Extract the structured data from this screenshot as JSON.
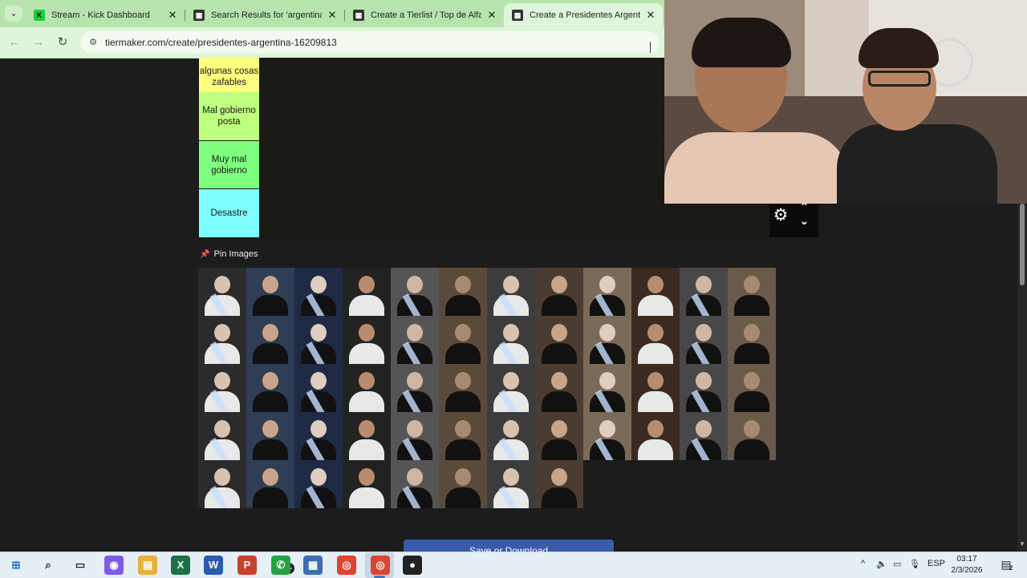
{
  "browser": {
    "tabs": [
      {
        "title": "Stream - Kick Dashboard",
        "favicon": "kick-icon",
        "active": false
      },
      {
        "title": "Search Results for 'argentina' -",
        "favicon": "tiermaker-icon",
        "active": false
      },
      {
        "title": "Create a Tierlist / Top de Alfajor",
        "favicon": "tiermaker-icon",
        "active": false
      },
      {
        "title": "Create a Presidentes Argentina",
        "favicon": "tiermaker-icon",
        "active": true
      }
    ],
    "tab_close": "✕",
    "tab_dropdown": "⌄",
    "nav": {
      "back": "←",
      "forward": "→",
      "reload": "↻",
      "site_info": "⚙"
    },
    "url": "tiermaker.com/create/presidentes-argentina-16209813"
  },
  "tierlist": {
    "tiers": [
      {
        "label": "algunas cosas zafables",
        "color": "#ffff7f"
      },
      {
        "label": "Mal gobierno posta",
        "color": "#bfff7f"
      },
      {
        "label": "Muy mal gobierno",
        "color": "#7fff7f"
      },
      {
        "label": "Desastre",
        "color": "#7fffff"
      }
    ],
    "settings": {
      "gear": "⚙",
      "up": "⌃",
      "down": "⌄"
    },
    "pin_label": "Pin Images",
    "pin_icon": "📌",
    "image_rows": [
      12,
      12,
      12,
      12,
      8
    ],
    "save_button": "Save or Download"
  },
  "taskbar": {
    "icons": [
      {
        "name": "windows-start-icon",
        "glyph": "⊞",
        "color": "#1a6fd1"
      },
      {
        "name": "search-icon",
        "glyph": "⌕",
        "color": "#222222"
      },
      {
        "name": "task-view-icon",
        "glyph": "▭",
        "color": "#222222"
      },
      {
        "name": "copilot-icon",
        "glyph": "◉",
        "color": "#7d5ce6"
      },
      {
        "name": "file-explorer-icon",
        "glyph": "▤",
        "color": "#e5b13c"
      },
      {
        "name": "excel-icon",
        "glyph": "X",
        "color": "#1d7044"
      },
      {
        "name": "word-icon",
        "glyph": "W",
        "color": "#2b5aae"
      },
      {
        "name": "powerpoint-icon",
        "glyph": "P",
        "color": "#c4432a"
      },
      {
        "name": "whatsapp-icon",
        "glyph": "✆",
        "color": "#25a144"
      },
      {
        "name": "calculator-icon",
        "glyph": "▦",
        "color": "#3d6fb0"
      },
      {
        "name": "chrome-icon",
        "glyph": "◎",
        "color": "#dd4433"
      },
      {
        "name": "chrome-profile-icon",
        "glyph": "◎",
        "color": "#dd4433"
      },
      {
        "name": "obs-icon",
        "glyph": "●",
        "color": "#222222"
      }
    ],
    "whatsapp_badge": "99+",
    "tray": {
      "chevron": "^",
      "volume": "🔈",
      "network": "▭",
      "mic": "🎙",
      "language": "ESP"
    },
    "time": "03:17",
    "date": "2/3/2026",
    "notifications": "2"
  }
}
